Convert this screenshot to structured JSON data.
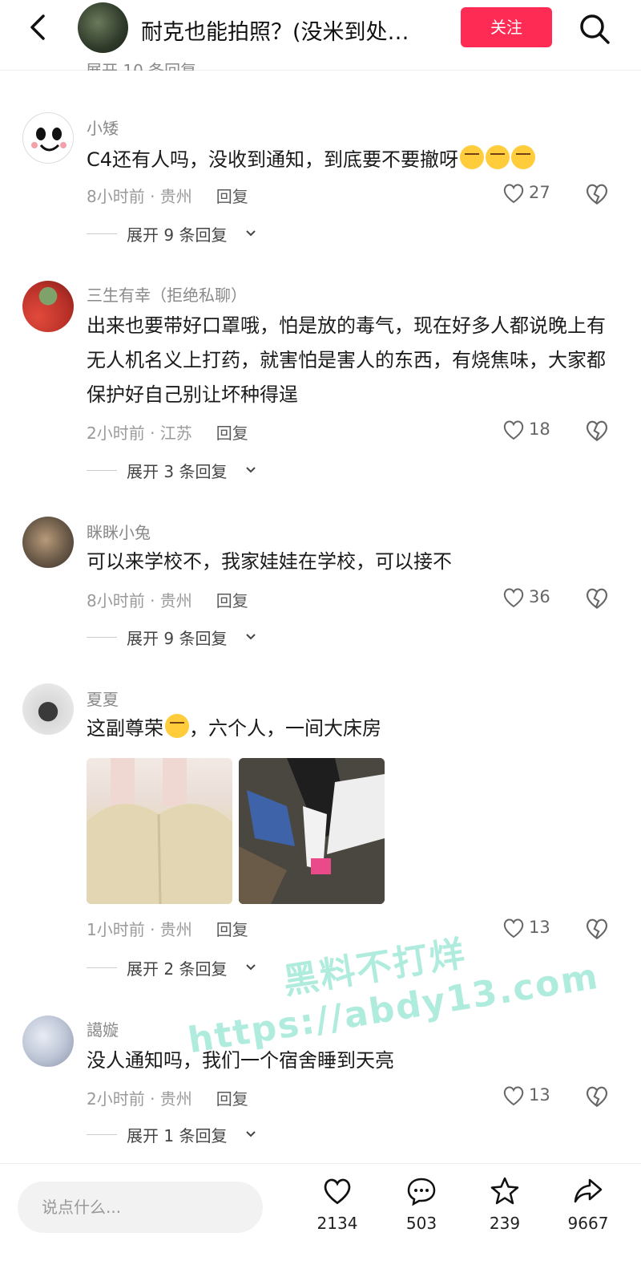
{
  "header": {
    "title": "耐克也能拍照？(没米到处…",
    "follow_label": "关注",
    "clipped_text": "展开 10 条回复"
  },
  "comments": [
    {
      "user": "小矮",
      "text": "C4还有人吗，没收到通知，到底要不要撤呀",
      "emoji_count": 3,
      "meta": "8小时前 · 贵州",
      "reply_label": "回复",
      "likes": "27",
      "expand": "展开 9 条回复"
    },
    {
      "user": "三生有幸（拒绝私聊）",
      "text": "出来也要带好口罩哦，怕是放的毒气，现在好多人都说晚上有无人机名义上打药，就害怕是害人的东西，有烧焦味，大家都保护好自己别让坏种得逞",
      "meta": "2小时前 · 江苏",
      "reply_label": "回复",
      "likes": "18",
      "expand": "展开 3 条回复"
    },
    {
      "user": "眯眯小兔",
      "text": "可以来学校不，我家娃娃在学校，可以接不",
      "meta": "8小时前 · 贵州",
      "reply_label": "回复",
      "likes": "36",
      "expand": "展开 9 条回复"
    },
    {
      "user": "夏夏",
      "text_before": "这副尊荣",
      "text_after": "，六个人，一间大床房",
      "meta": "1小时前 · 贵州",
      "reply_label": "回复",
      "likes": "13",
      "expand": "展开 2 条回复"
    },
    {
      "user": "譪嫙",
      "text": "没人通知吗，我们一个宿舍睡到天亮",
      "meta": "2小时前 · 贵州",
      "reply_label": "回复",
      "likes": "13",
      "expand": "展开 1 条回复"
    }
  ],
  "watermark": {
    "line1": "黑料不打烊",
    "line2": "https://abdy13.com"
  },
  "bottom_bar": {
    "placeholder": "说点什么...",
    "likes": "2134",
    "comments": "503",
    "favorites": "239",
    "shares": "9667"
  },
  "colors": {
    "accent": "#fe2c55",
    "watermark": "#96e6d2"
  }
}
